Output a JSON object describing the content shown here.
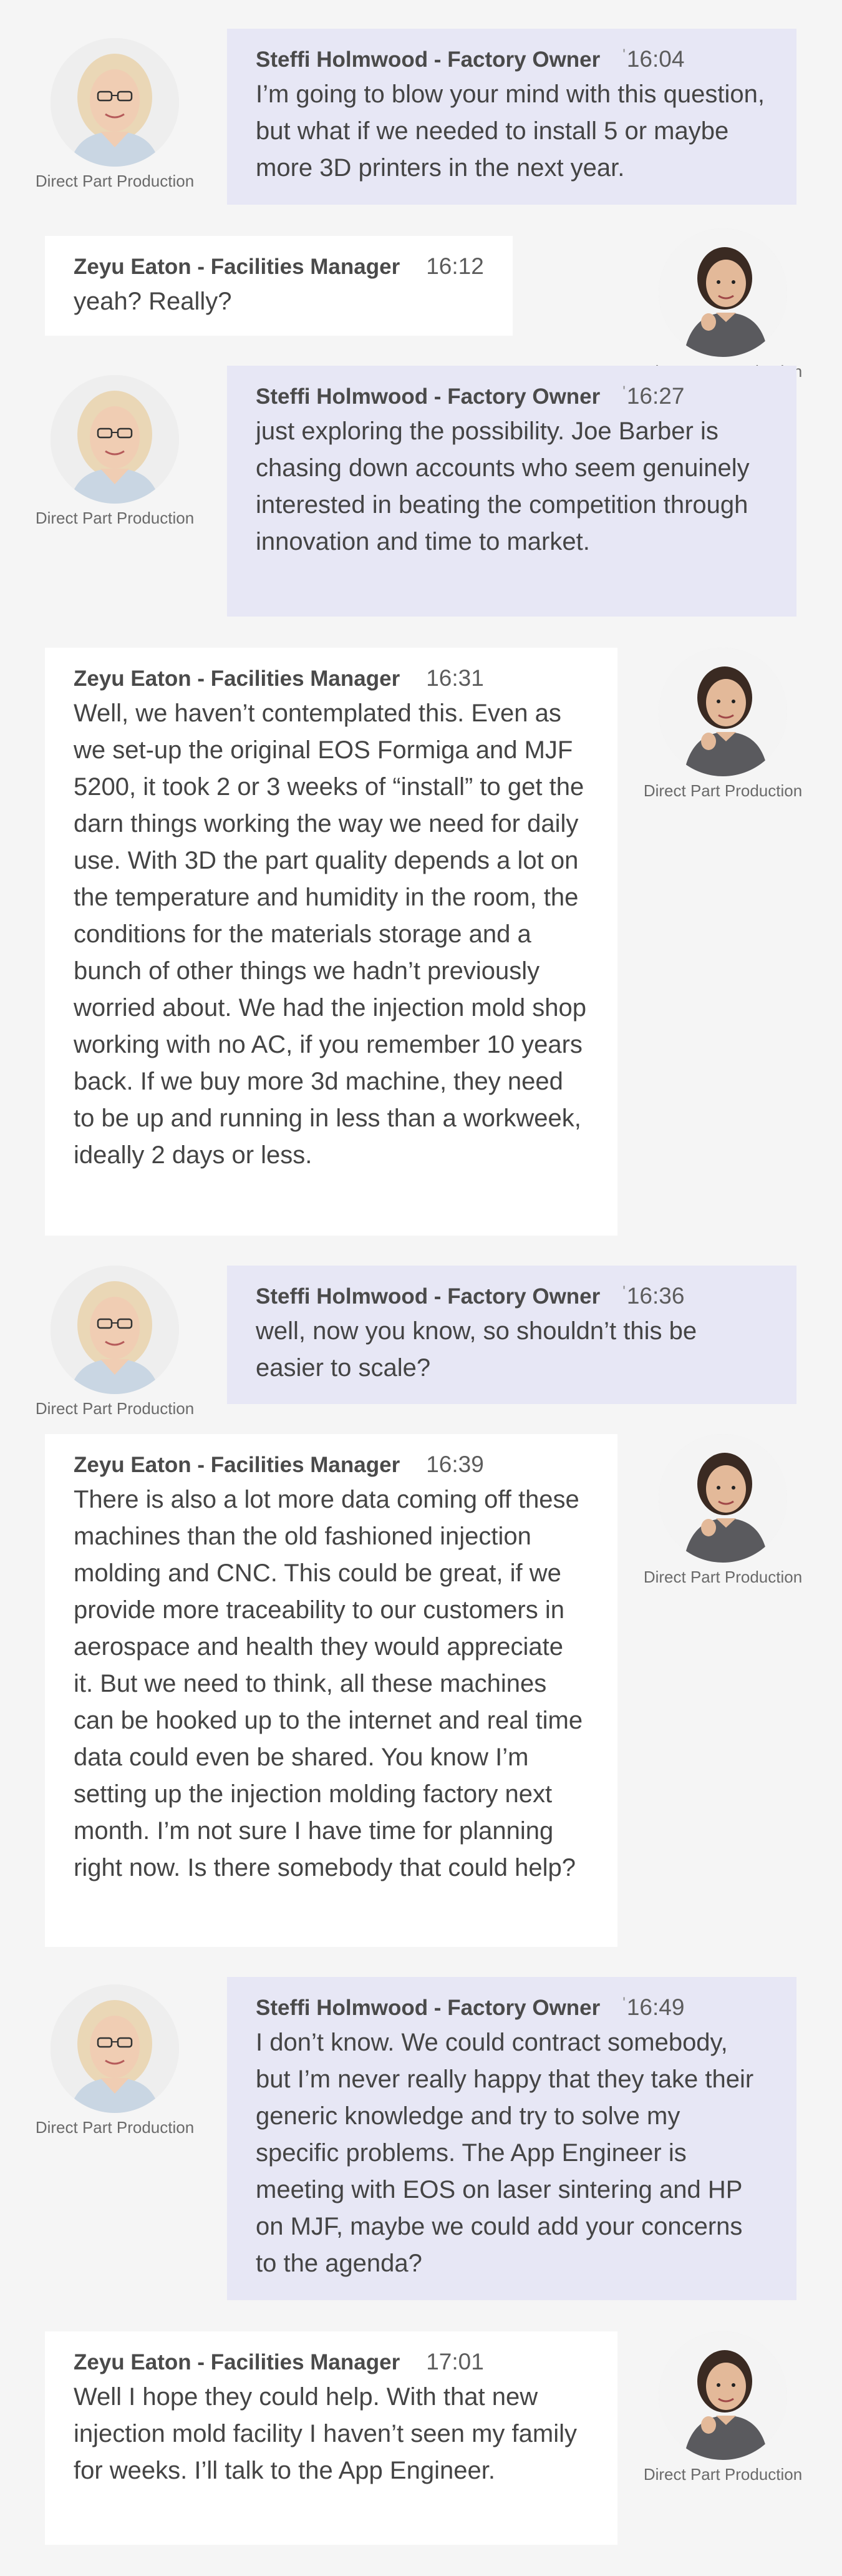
{
  "participants": {
    "owner": {
      "name": "Steffi Holmwood - Factory Owner",
      "caption": "Direct Part Production"
    },
    "manager": {
      "name": "Zeyu Eaton - Facilities Manager",
      "caption": "Direct Part Production"
    }
  },
  "messages": [
    {
      "time": "16:04",
      "text": "I’m going to blow your mind with this question, but what if we needed to install 5 or maybe more 3D printers in the next year."
    },
    {
      "time": "16:12",
      "text": "yeah? Really?"
    },
    {
      "time": "16:27",
      "text": "just exploring the possibility. Joe Barber is chasing down accounts who seem genuinely interested in beating the competition through innovation and time to market."
    },
    {
      "time": "16:31",
      "text": "Well, we haven’t contemplated this. Even as we set-up the original EOS Formiga and MJF 5200, it took 2 or 3 weeks of “install” to get the darn things working the way we need for daily use. With 3D the part quality depends a lot on the temperature and humidity in the room, the conditions for the materials storage and a bunch of other things we hadn’t previously worried about. We had the injection mold shop working with no AC, if you remember 10 years back. If we buy more 3d machine, they need to be up and running in less than a workweek, ideally 2 days or less."
    },
    {
      "time": "16:36",
      "text": "well, now you know, so shouldn’t this be easier to scale?"
    },
    {
      "time": "16:39",
      "text": "There is also a lot more data coming off these machines than the old fashioned injection molding and CNC. This could be great, if we provide more traceability to our customers in aerospace and health they would appreciate it. But we need to think, all these machines can be hooked up to the internet and real time data could even be shared. You know I’m setting up the injection molding factory next month. I’m not sure I have time for planning right now. Is there somebody that could help?"
    },
    {
      "time": "16:49",
      "text": "I don’t know. We could contract somebody, but I’m never really happy that they take their generic knowledge and try to solve my specific problems. The App Engineer is meeting with EOS on laser sintering and HP on MJF, maybe we could add your concerns to the agenda?"
    },
    {
      "time": "17:01",
      "text": "Well I hope they could help. With that new injection mold facility I haven’t seen my family for weeks. I’ll talk to the App Engineer."
    }
  ]
}
